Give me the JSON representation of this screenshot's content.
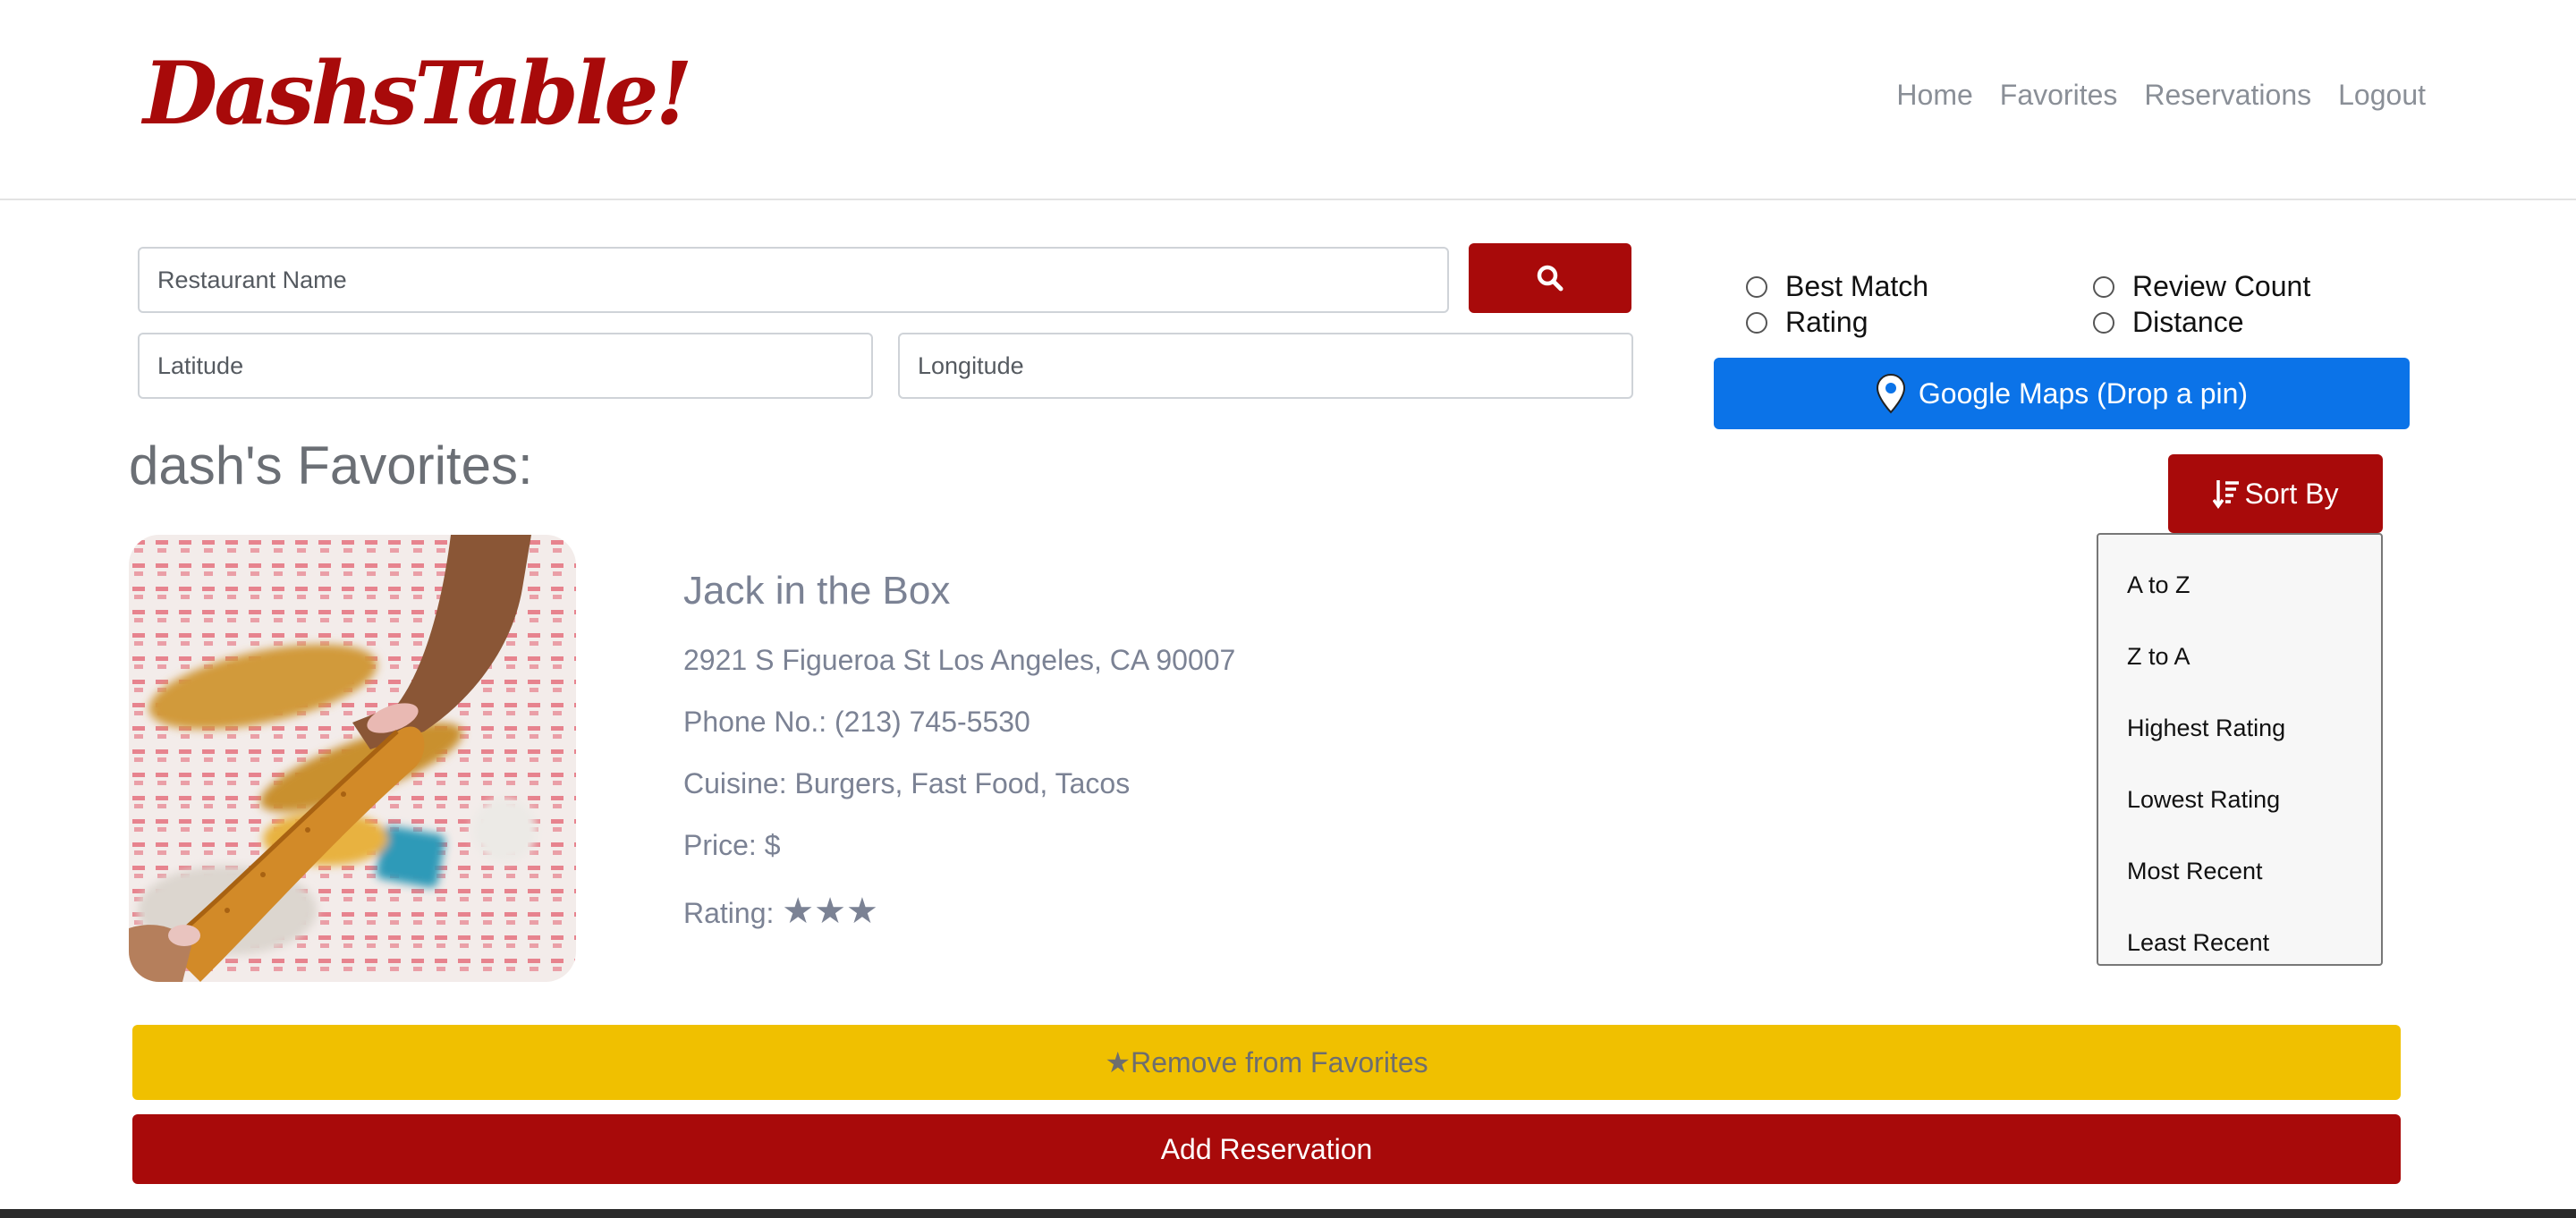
{
  "header": {
    "logo": "DashsTable!",
    "nav": [
      "Home",
      "Favorites",
      "Reservations",
      "Logout"
    ]
  },
  "search": {
    "name_placeholder": "Restaurant Name",
    "lat_placeholder": "Latitude",
    "lng_placeholder": "Longitude",
    "button_icon": "search-icon"
  },
  "sort_options": {
    "best_match": "Best Match",
    "review_count": "Review Count",
    "rating": "Rating",
    "distance": "Distance"
  },
  "maps_button": {
    "label": "Google Maps (Drop a pin)",
    "icon": "map-pin-icon"
  },
  "favorites": {
    "title": "dash's Favorites:",
    "sort_button": "Sort By",
    "sort_icon": "sort-descending-icon",
    "dropdown": [
      "A to Z",
      "Z to A",
      "Highest Rating",
      "Lowest Rating",
      "Most Recent",
      "Least Recent"
    ]
  },
  "restaurant": {
    "name": "Jack in the Box",
    "address": "2921 S Figueroa St Los Angeles, CA 90007",
    "phone": "Phone No.: (213) 745-5530",
    "cuisine": "Cuisine: Burgers, Fast Food, Tacos",
    "price": "Price: $",
    "rating_label": "Rating: ",
    "rating_stars": "★★★",
    "rating_value": 3
  },
  "actions": {
    "remove": "★Remove from Favorites",
    "add_reservation": "Add Reservation"
  },
  "colors": {
    "brand_red": "#a80a0a",
    "maps_blue": "#0b73e8",
    "favorite_yellow": "#f0c000",
    "text_gray": "#7b8294"
  }
}
